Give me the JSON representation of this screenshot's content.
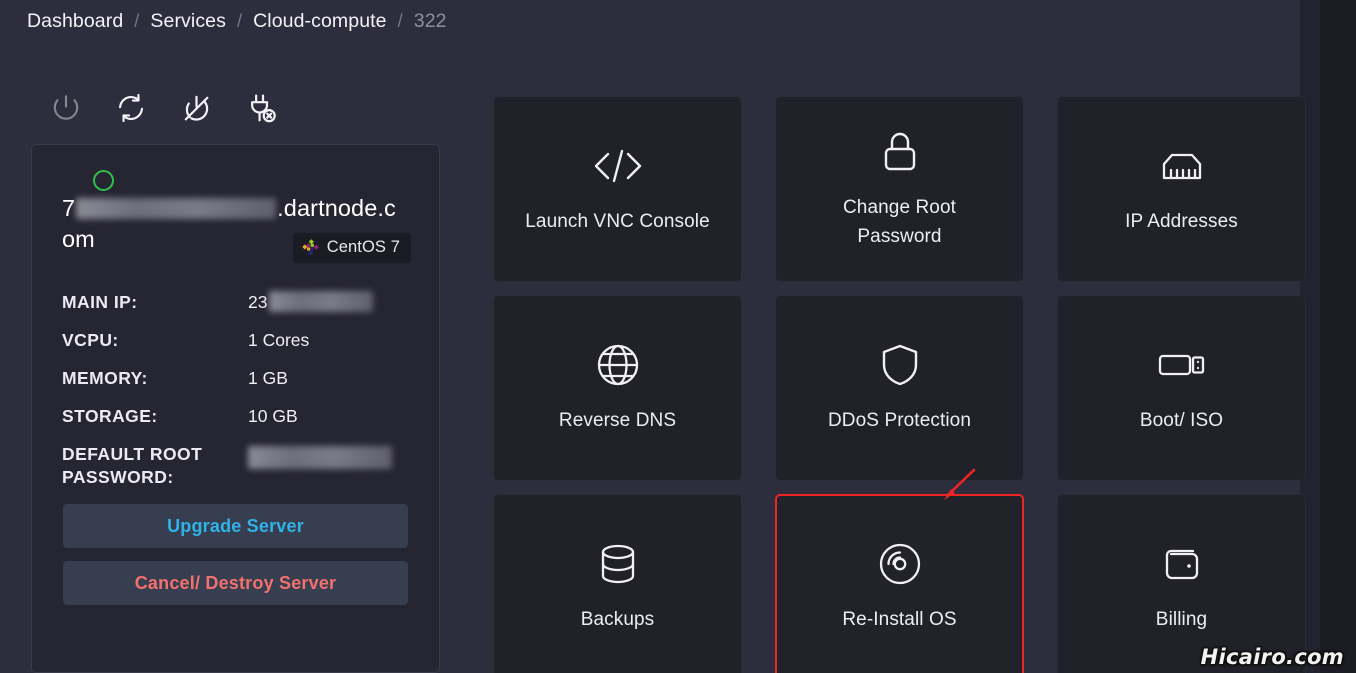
{
  "breadcrumb": {
    "items": [
      {
        "label": "Dashboard",
        "dim": false
      },
      {
        "label": "Services",
        "dim": false
      },
      {
        "label": "Cloud-compute",
        "dim": false
      },
      {
        "label": "322",
        "dim": true
      }
    ],
    "separator": "/"
  },
  "toolbar": {
    "buttons": [
      {
        "name": "power-icon",
        "title": "Power On/Off",
        "state": "disabled"
      },
      {
        "name": "restart-icon",
        "title": "Restart",
        "state": "enabled"
      },
      {
        "name": "power-off-slash-icon",
        "title": "Force Shutdown",
        "state": "enabled"
      },
      {
        "name": "plug-disconnect-icon",
        "title": "Disconnect",
        "state": "enabled"
      }
    ]
  },
  "server_panel": {
    "status": "online",
    "status_color": "#2fc04a",
    "hostname_prefix": "7",
    "hostname_suffix": ".dartnode.com",
    "os_badge": "CentOS 7",
    "specs": [
      {
        "key": "MAIN IP:",
        "value": "23",
        "redacted": true
      },
      {
        "key": "VCPU:",
        "value": "1 Cores",
        "redacted": false
      },
      {
        "key": "MEMORY:",
        "value": "1 GB",
        "redacted": false
      },
      {
        "key": "STORAGE:",
        "value": "10 GB",
        "redacted": false
      },
      {
        "key": "DEFAULT ROOT PASSWORD:",
        "value": "",
        "redacted": true
      }
    ],
    "upgrade_label": "Upgrade Server",
    "destroy_label": "Cancel/ Destroy Server",
    "upgrade_color": "#2fb3e8",
    "destroy_color": "#f2706e"
  },
  "cards": [
    {
      "label": "Launch VNC Console",
      "icon": "code-brackets-icon",
      "highlighted": false
    },
    {
      "label": "Change Root Password",
      "icon": "lock-icon",
      "highlighted": false
    },
    {
      "label": "IP Addresses",
      "icon": "ethernet-port-icon",
      "highlighted": false
    },
    {
      "label": "Reverse DNS",
      "icon": "globe-icon",
      "highlighted": false
    },
    {
      "label": "DDoS Protection",
      "icon": "shield-icon",
      "highlighted": false
    },
    {
      "label": "Boot/ ISO",
      "icon": "usb-drive-icon",
      "highlighted": false
    },
    {
      "label": "Backups",
      "icon": "database-icon",
      "highlighted": false
    },
    {
      "label": "Re-Install OS",
      "icon": "disc-icon",
      "highlighted": true
    },
    {
      "label": "Billing",
      "icon": "wallet-icon",
      "highlighted": false
    }
  ],
  "annotation": {
    "arrow_color": "#ef2424",
    "highlight_color": "#ef2424"
  },
  "watermark": {
    "text": "Hicairo.com"
  }
}
